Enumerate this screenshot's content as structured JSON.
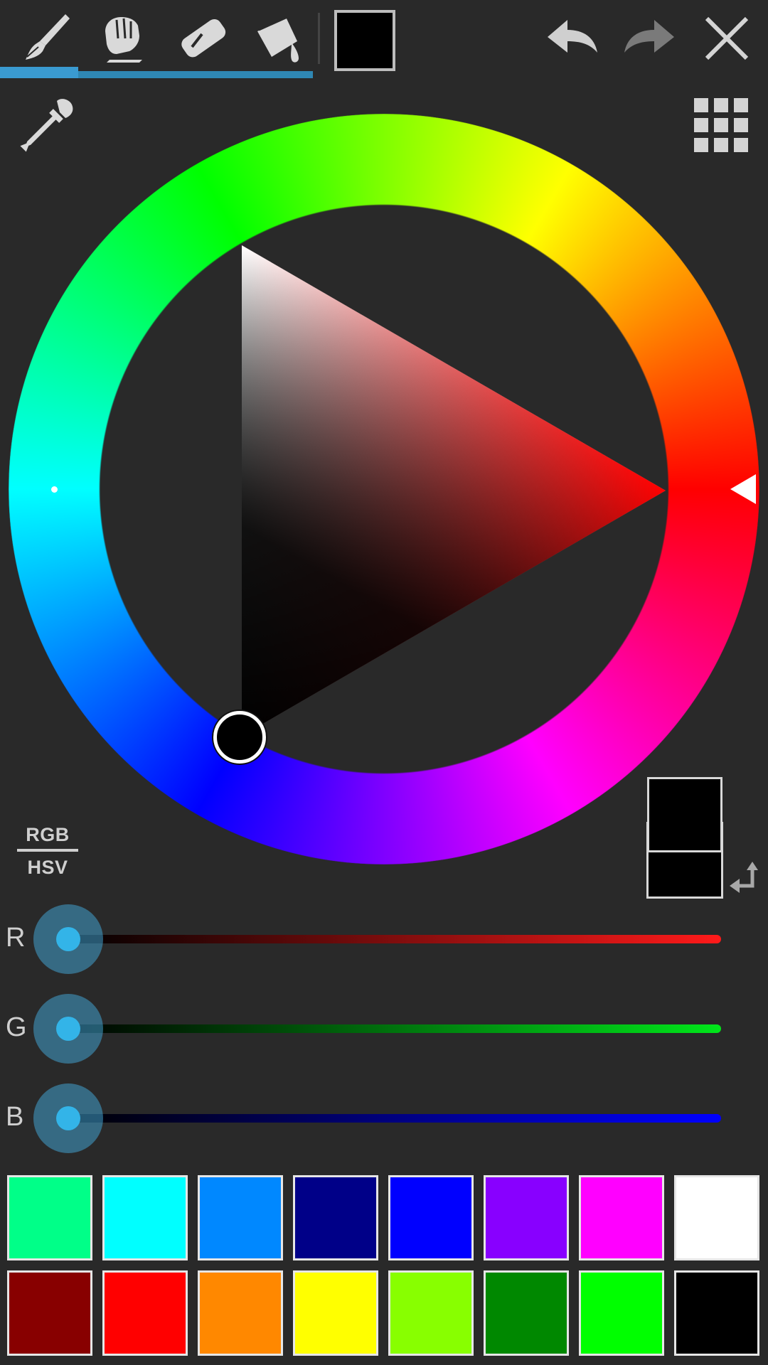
{
  "toolbar": {
    "tools": [
      {
        "name": "brush-tool",
        "icon": "brush-icon"
      },
      {
        "name": "smudge-tool",
        "icon": "smudge-hand-icon"
      },
      {
        "name": "eraser-tool",
        "icon": "eraser-icon"
      },
      {
        "name": "fill-tool",
        "icon": "bucket-fill-icon"
      }
    ],
    "current_color": "#000000",
    "actions": [
      "undo-icon",
      "redo-icon",
      "close-icon"
    ]
  },
  "picker": {
    "eyedropper_icon": "eyedropper-icon",
    "palette_grid_icon": "grid-icon",
    "hue_color": "#ff0000",
    "selected_color": "#000000"
  },
  "mode": {
    "top": "RGB",
    "bottom": "HSV"
  },
  "preview": {
    "previous": "#000000",
    "current": "#000000",
    "swap_icon": "swap-arrow-icon"
  },
  "sliders": [
    {
      "label": "R",
      "value": 0,
      "color": "#ff1a1a"
    },
    {
      "label": "G",
      "value": 0,
      "color": "#00e61a"
    },
    {
      "label": "B",
      "value": 0,
      "color": "#0000ff"
    }
  ],
  "palette": [
    [
      "#00ff88",
      "#00ffff",
      "#0088ff",
      "#000088",
      "#0000ff",
      "#8800ff",
      "#ff00ff",
      "#ffffff"
    ],
    [
      "#880000",
      "#ff0000",
      "#ff8800",
      "#ffff00",
      "#88ff00",
      "#008800",
      "#00ff00",
      "#000000"
    ]
  ]
}
